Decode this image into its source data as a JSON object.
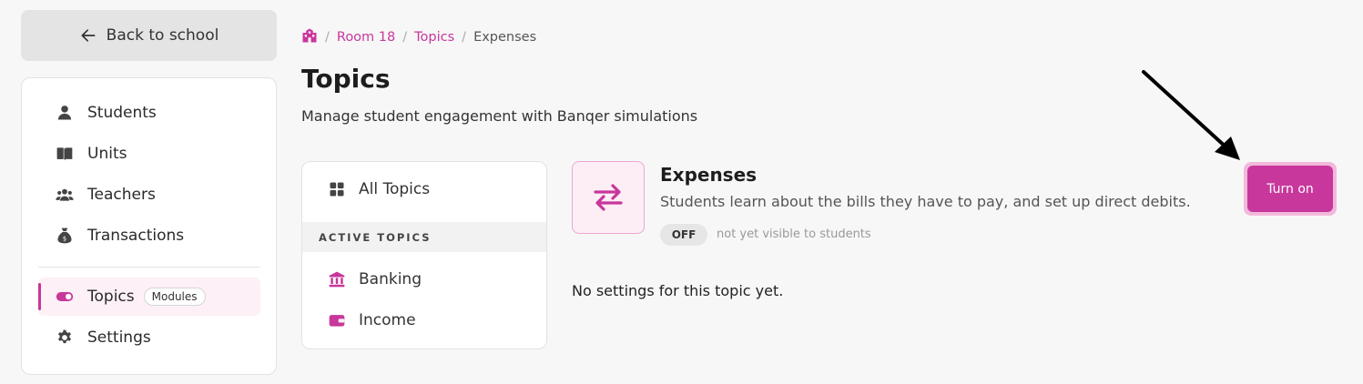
{
  "sidebar": {
    "back_label": "Back to school",
    "items": [
      {
        "label": "Students",
        "icon": "user-icon"
      },
      {
        "label": "Units",
        "icon": "book-icon"
      },
      {
        "label": "Teachers",
        "icon": "users-icon"
      },
      {
        "label": "Transactions",
        "icon": "money-bag-icon"
      },
      {
        "label": "Topics",
        "icon": "toggle-icon",
        "badge": "Modules",
        "active": true
      },
      {
        "label": "Settings",
        "icon": "gear-icon"
      }
    ]
  },
  "breadcrumb": {
    "home_icon": "school-icon",
    "items": [
      "Room 18",
      "Topics"
    ],
    "current": "Expenses"
  },
  "header": {
    "title": "Topics",
    "subtitle": "Manage student engagement with Banqer simulations"
  },
  "topics_nav": {
    "all_label": "All Topics",
    "section_label": "ACTIVE TOPICS",
    "items": [
      {
        "label": "Banking",
        "icon": "bank-icon"
      },
      {
        "label": "Income",
        "icon": "wallet-icon"
      }
    ]
  },
  "topic": {
    "name": "Expenses",
    "icon": "swap-arrows-icon",
    "description": "Students learn about the bills they have to pay, and set up direct debits.",
    "status": "OFF",
    "status_note": "not yet visible to students",
    "action_label": "Turn on",
    "empty_settings": "No settings for this topic yet."
  },
  "colors": {
    "accent": "#c8379b",
    "accent_soft": "#fdeef6"
  }
}
